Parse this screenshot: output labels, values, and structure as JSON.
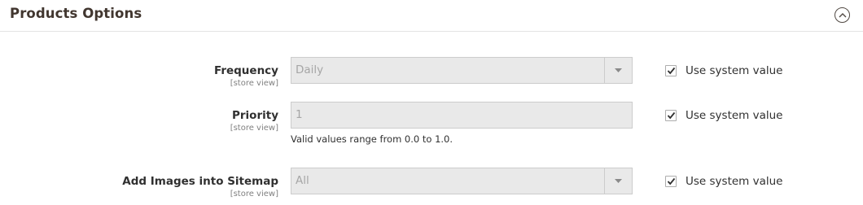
{
  "section": {
    "title": "Products Options",
    "toggle_icon": "chevron-up-circle-icon"
  },
  "fields": [
    {
      "label": "Frequency",
      "scope": "[store view]",
      "type": "select",
      "value": "Daily",
      "use_system_value": true,
      "use_system_label": "Use system value"
    },
    {
      "label": "Priority",
      "scope": "[store view]",
      "type": "text",
      "value": "1",
      "note": "Valid values range from 0.0 to 1.0.",
      "use_system_value": true,
      "use_system_label": "Use system value"
    },
    {
      "label": "Add Images into Sitemap",
      "scope": "[store view]",
      "type": "select",
      "value": "All",
      "use_system_value": true,
      "use_system_label": "Use system value"
    }
  ],
  "colors": {
    "disabled_bg": "#e9e9e9",
    "border": "#cccccc",
    "text": "#303030",
    "muted": "#808080"
  }
}
